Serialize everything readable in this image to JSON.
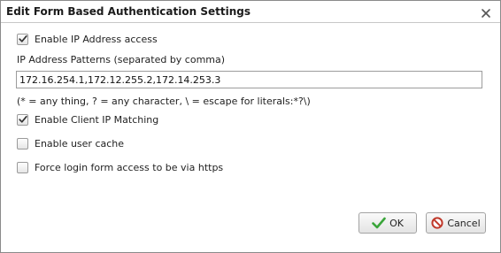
{
  "dialog": {
    "title": "Edit Form Based Authentication Settings",
    "close_icon": "close-icon"
  },
  "options": {
    "enable_ip_access": {
      "label": "Enable IP Address access",
      "checked": true
    },
    "client_ip_matching": {
      "label": "Enable Client IP Matching",
      "checked": true
    },
    "user_cache": {
      "label": "Enable user cache",
      "checked": false
    },
    "force_https": {
      "label": "Force login form access to be via https",
      "checked": false
    }
  },
  "ip_patterns": {
    "label": "IP Address Patterns (separated by comma)",
    "value": "172.16.254.1,172.12.255.2,172.14.253.3",
    "hint": "(* = any thing, ? = any character, \\ = escape for literals:*?\\)"
  },
  "buttons": {
    "ok_label": "OK",
    "cancel_label": "Cancel",
    "ok_icon": "checkmark-icon",
    "cancel_icon": "cancel-icon"
  },
  "colors": {
    "ok_green": "#3aa53a",
    "cancel_red": "#c0392b"
  }
}
